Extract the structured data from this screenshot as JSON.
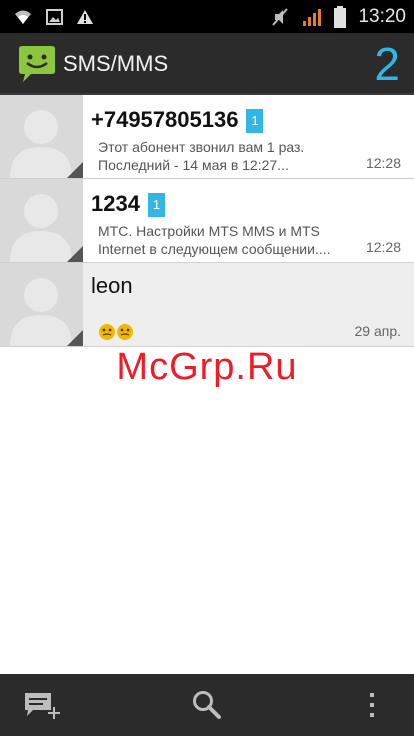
{
  "status_bar": {
    "time": "13:20",
    "icons": [
      "wifi-icon",
      "image-icon",
      "warning-icon",
      "mute-icon",
      "signal-icon",
      "battery-icon"
    ]
  },
  "action_bar": {
    "title": "SMS/MMS",
    "unread_count": "2",
    "icon": "sms-app-icon",
    "accent_color": "#33b5e5"
  },
  "conversations": [
    {
      "name": "+74957805136",
      "badge": "1",
      "snippet_line1": "Этот абонент звонил вам 1 раз.",
      "snippet_line2": "Последний -  14 мая в 12:27...",
      "time": "12:28",
      "unread": true
    },
    {
      "name": "1234",
      "badge": "1",
      "snippet_line1": "МТС. Настройки MTS MMS и MTS",
      "snippet_line2": "Internet в следующем сообщении....",
      "time": "12:28",
      "unread": true
    },
    {
      "name": "leon",
      "preview": "emoji-stickers",
      "time": "29 апр.",
      "unread": false
    }
  ],
  "watermark": "McGrp.Ru",
  "bottom_bar": {
    "buttons": [
      "new-message-icon",
      "search-icon",
      "overflow-menu-icon"
    ]
  }
}
